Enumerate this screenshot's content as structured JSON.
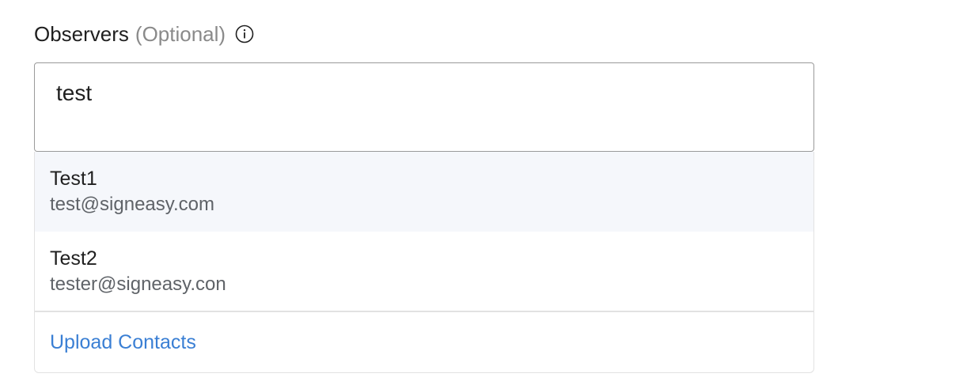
{
  "field": {
    "label": "Observers",
    "optional_text": "(Optional)",
    "info_icon": "info-icon",
    "input_value": "test"
  },
  "suggestions": [
    {
      "name": "Test1",
      "email": "test@signeasy.com",
      "highlighted": true
    },
    {
      "name": "Test2",
      "email": "tester@signeasy.con",
      "highlighted": false
    }
  ],
  "upload_contacts_label": "Upload Contacts",
  "colors": {
    "link": "#3a7fd4",
    "highlight_bg": "#f5f7fb",
    "muted_text": "#8a8a8a",
    "email_text": "#5f6368"
  }
}
